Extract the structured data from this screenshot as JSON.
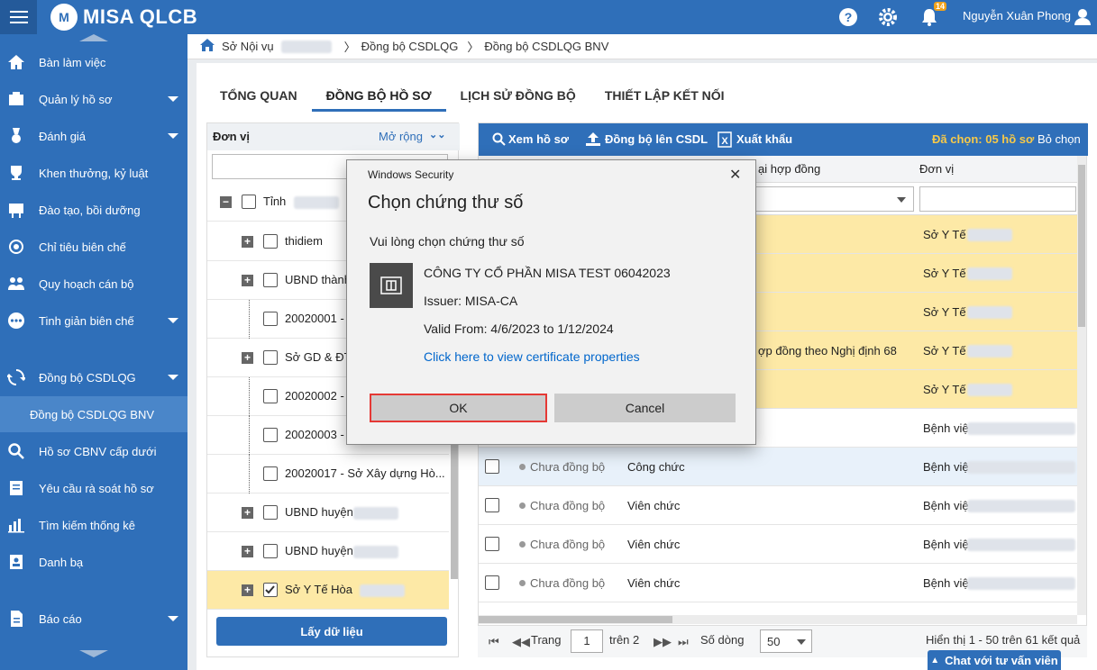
{
  "app": {
    "title": "MISA QLCB",
    "user": "Nguyễn Xuân Phong",
    "notif_count": "14"
  },
  "breadcrumb": [
    "Sở Nội vụ",
    "Đồng bộ CSDLQG",
    "Đồng bộ CSDLQG BNV"
  ],
  "sidebar": {
    "items": [
      {
        "label": "Bàn làm việc",
        "icon": "home-icon",
        "arrow": false
      },
      {
        "label": "Quản lý hồ sơ",
        "icon": "profile-icon",
        "arrow": true
      },
      {
        "label": "Đánh giá",
        "icon": "medal-icon",
        "arrow": true
      },
      {
        "label": "Khen thưởng, kỷ luật",
        "icon": "trophy-icon",
        "arrow": false
      },
      {
        "label": "Đào tạo, bồi dưỡng",
        "icon": "training-icon",
        "arrow": false
      },
      {
        "label": "Chỉ tiêu biên chế",
        "icon": "target-icon",
        "arrow": false
      },
      {
        "label": "Quy hoạch cán bộ",
        "icon": "people-icon",
        "arrow": false
      },
      {
        "label": "Tinh giản biên chế",
        "icon": "more-icon",
        "arrow": true
      },
      {
        "label": "Đồng bộ CSDLQG",
        "icon": "sync-icon",
        "arrow": true
      },
      {
        "label": "Đồng bộ CSDLQG BNV",
        "icon": "",
        "arrow": false
      },
      {
        "label": "Hồ sơ CBNV cấp dưới",
        "icon": "search-icon",
        "arrow": false
      },
      {
        "label": "Yêu cầu rà soát hồ sơ",
        "icon": "request-icon",
        "arrow": false
      },
      {
        "label": "Tìm kiếm thống kê",
        "icon": "stats-icon",
        "arrow": false
      },
      {
        "label": "Danh bạ",
        "icon": "contacts-icon",
        "arrow": false
      },
      {
        "label": "Báo cáo",
        "icon": "report-icon",
        "arrow": true
      }
    ]
  },
  "tabs": [
    "TỔNG QUAN",
    "ĐỒNG BỘ HỒ SƠ",
    "LỊCH SỬ ĐỒNG BỘ",
    "THIẾT LẬP KẾT NỐI"
  ],
  "tree": {
    "header": "Đơn vị",
    "expand": "Mở rộng",
    "rows": [
      {
        "label": "Tỉnh",
        "checked": false
      },
      {
        "label": "thidiem",
        "checked": false
      },
      {
        "label": "UBND thành",
        "checked": false
      },
      {
        "label": "20020001 -",
        "checked": false
      },
      {
        "label": "Sở GD & ĐT",
        "checked": false
      },
      {
        "label": "20020002 -",
        "checked": false
      },
      {
        "label": "20020003 -",
        "checked": false
      },
      {
        "label": "20020017 - Sở Xây dựng Hò...",
        "checked": false
      },
      {
        "label": "UBND huyện",
        "checked": false
      },
      {
        "label": "UBND huyện",
        "checked": false
      },
      {
        "label": "Sở Y Tế Hòa",
        "checked": true
      }
    ],
    "button": "Lấy dữ liệu"
  },
  "grid": {
    "toolbar": {
      "view": "Xem hồ sơ",
      "sync": "Đồng bộ lên CSDL",
      "export": "Xuất khẩu",
      "selected": "Đã chọn: 05 hồ sơ",
      "deselect": "Bỏ chọn"
    },
    "headers": {
      "contract": "ại hợp đồng",
      "unit": "Đơn vị"
    },
    "rows": [
      {
        "status": "",
        "type": "",
        "unit": "Sở Y Tế",
        "sel": true
      },
      {
        "status": "",
        "type": "",
        "unit": "Sở Y Tế",
        "sel": true
      },
      {
        "status": "",
        "type": "",
        "unit": "Sở Y Tế",
        "sel": true
      },
      {
        "status": "",
        "type": "ợp đồng theo Nghị định 68",
        "unit": "Sở Y Tế",
        "sel": true
      },
      {
        "status": "",
        "type": "",
        "unit": "Sở Y Tế",
        "sel": true
      },
      {
        "status": "",
        "type": "",
        "unit": "Bệnh việ",
        "sel": false
      },
      {
        "status": "Chưa đồng bộ",
        "type": "Công chức",
        "unit": "Bệnh việ",
        "sel": false
      },
      {
        "status": "Chưa đồng bộ",
        "type": "Viên chức",
        "unit": "Bệnh việ",
        "sel": false
      },
      {
        "status": "Chưa đồng bộ",
        "type": "Viên chức",
        "unit": "Bệnh việ",
        "sel": false
      },
      {
        "status": "Chưa đồng bộ",
        "type": "Viên chức",
        "unit": "Bệnh việ",
        "sel": false
      }
    ],
    "pager": {
      "page_label": "Trang",
      "page": "1",
      "of": "trên 2",
      "rows_label": "Số dòng",
      "rows": "50",
      "summary": "Hiển thị 1 - 50 trên 61 kết quả"
    }
  },
  "dialog": {
    "window_title": "Windows Security",
    "title": "Chọn chứng thư số",
    "prompt": "Vui lòng chọn chứng thư số",
    "cert_name": "CÔNG TY CỔ PHẦN MISA TEST 06042023",
    "issuer": "Issuer: MISA-CA",
    "valid": "Valid From: 4/6/2023 to 1/12/2024",
    "link": "Click here to view certificate properties",
    "ok": "OK",
    "cancel": "Cancel"
  },
  "chat": "Chat với tư vấn viên"
}
